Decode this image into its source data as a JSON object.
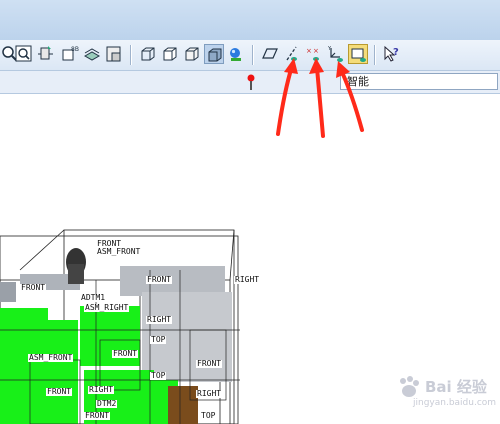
{
  "toolbar": {
    "buttons": [
      "zoom-icon",
      "zoom-window-icon",
      "refit-icon",
      "spin-center-icon",
      "layers-icon",
      "saved-views-icon",
      "wireframe-icon",
      "hidden-line-icon",
      "no-hidden-icon",
      "shading-icon",
      "appearance-icon",
      "datum-planes-icon",
      "datum-axes-icon",
      "datum-points-icon",
      "coord-sys-icon",
      "annotation-icon",
      "whats-this-icon"
    ]
  },
  "subbar": {
    "filter_label": "智能"
  },
  "model": {
    "labels": [
      "FRONT",
      "ASM_FRONT",
      "FRONT",
      "FRONT",
      "RIGHT",
      "ADTM1",
      "ASM_RIGHT",
      "RIGHT",
      "TOP",
      "FRONT",
      "ASM_FRONT",
      "FRONT",
      "RIGHT",
      "TOP",
      "FRONT",
      "DTM2",
      "RIGHT",
      "FRONT",
      "TOP"
    ]
  },
  "watermark": {
    "brand": "Bai 经验",
    "url": "jingyan.baidu.com"
  },
  "colors": {
    "arrow": "#ff2a1a",
    "part_green": "#18f018",
    "part_gray": "#b8bcc2",
    "toolbar_bg": "#dbe7f5"
  }
}
